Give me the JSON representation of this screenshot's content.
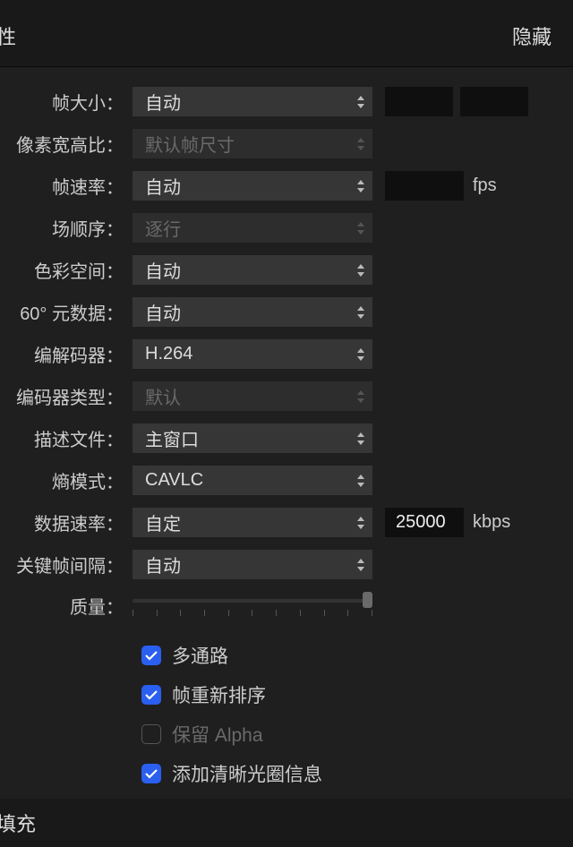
{
  "header": {
    "leftTitle": "性",
    "hide": "隐藏"
  },
  "rows": {
    "frameSize": {
      "label": "帧大小：",
      "value": "自动"
    },
    "pixelAspect": {
      "label": "像素宽高比：",
      "value": "默认帧尺寸"
    },
    "frameRate": {
      "label": "帧速率：",
      "value": "自动",
      "unit": "fps"
    },
    "fieldOrder": {
      "label": "场顺序：",
      "value": "逐行"
    },
    "colorSpace": {
      "label": "色彩空间：",
      "value": "自动"
    },
    "metadata360": {
      "label": "60° 元数据：",
      "value": "自动"
    },
    "codec": {
      "label": "编解码器：",
      "value": "H.264"
    },
    "encoderType": {
      "label": "编码器类型：",
      "value": "默认"
    },
    "profileFile": {
      "label": "描述文件：",
      "value": "主窗口"
    },
    "entropyMode": {
      "label": "熵模式：",
      "value": "CAVLC"
    },
    "dataRate": {
      "label": "数据速率：",
      "value": "自定",
      "input": "25000",
      "unit": "kbps"
    },
    "keyframeInterval": {
      "label": "关键帧间隔：",
      "value": "自动"
    },
    "quality": {
      "label": "质量："
    }
  },
  "checkboxes": {
    "multipass": {
      "label": "多通路",
      "checked": true
    },
    "frameReorder": {
      "label": "帧重新排序",
      "checked": true
    },
    "keepAlpha": {
      "label": "保留 Alpha",
      "checked": false
    },
    "addCleanAperture": {
      "label": "添加清晰光圈信息",
      "checked": true
    }
  },
  "footer": {
    "text": "填充"
  }
}
